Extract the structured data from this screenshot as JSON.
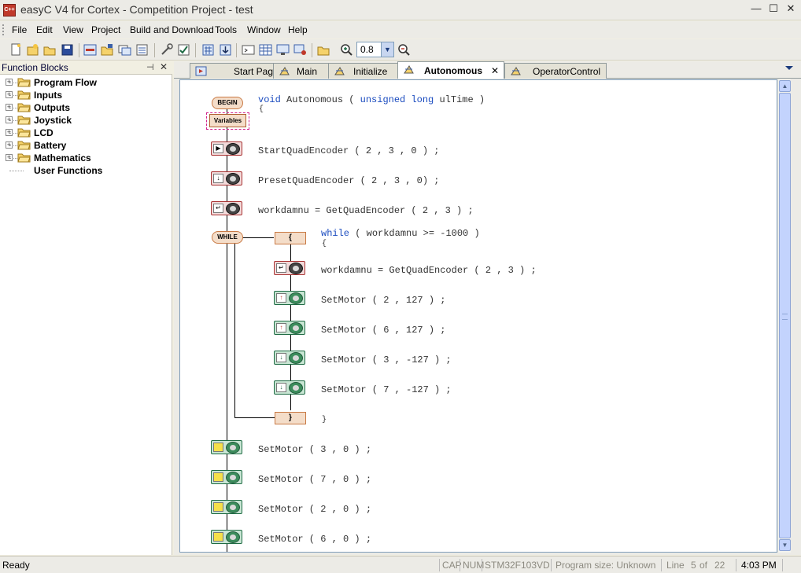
{
  "window": {
    "icon_label": "C++",
    "title": "easyC V4 for Cortex - Competition Project - test",
    "minimize": "—",
    "maximize": "☐",
    "close": "✕"
  },
  "menu": [
    "File",
    "Edit",
    "View",
    "Project",
    "Build and Download",
    "Tools",
    "Window",
    "Help"
  ],
  "toolbar": {
    "zoom_value": "0.8",
    "zoom_arrow": "▼"
  },
  "sidebar": {
    "title": "Function Blocks",
    "pin": "⊣",
    "close": "✕",
    "items": [
      {
        "label": "Program Flow",
        "expandable": true
      },
      {
        "label": "Inputs",
        "expandable": true
      },
      {
        "label": "Outputs",
        "expandable": true
      },
      {
        "label": "Joystick",
        "expandable": true
      },
      {
        "label": "LCD",
        "expandable": true
      },
      {
        "label": "Battery",
        "expandable": true
      },
      {
        "label": "Mathematics",
        "expandable": true
      },
      {
        "label": "User Functions",
        "expandable": false
      }
    ]
  },
  "tabs": [
    {
      "label": "Start Page"
    },
    {
      "label": "Main"
    },
    {
      "label": "Initialize"
    },
    {
      "label": "Autonomous",
      "active": true
    },
    {
      "label": "OperatorControl"
    }
  ],
  "tab_close": "✕",
  "editor": {
    "begin_label": "BEGIN",
    "variables_label": "Variables",
    "while_label": "WHILE",
    "loop_open": "{",
    "loop_close": "}",
    "header": {
      "kw1": "void",
      "name": "Autonomous",
      "paren_open": "(",
      "kw2": "unsigned long",
      "param": "ulTime",
      "paren_close": ")",
      "brace": "{"
    },
    "lines": [
      "StartQuadEncoder ( 2 , 3 , 0 ) ;",
      "PresetQuadEncoder ( 2 , 3 , 0) ;",
      "workdamnu = GetQuadEncoder ( 2 , 3 ) ;"
    ],
    "while_line": {
      "kw": "while",
      "cond": "( workdamnu >= -1000 )",
      "brace": "{"
    },
    "loop_lines": [
      "workdamnu = GetQuadEncoder ( 2 , 3 ) ;",
      "SetMotor ( 2 , 127 ) ;",
      "SetMotor ( 6 , 127 ) ;",
      "SetMotor ( 3 , -127 ) ;",
      "SetMotor ( 7 , -127 ) ;"
    ],
    "loop_end_brace": "}",
    "after_lines": [
      "SetMotor ( 3 , 0 ) ;",
      "SetMotor ( 7 , 0 ) ;",
      "SetMotor ( 2 , 0 ) ;",
      "SetMotor ( 6 , 0 ) ;"
    ]
  },
  "scrollbar": {
    "up": "▲",
    "down": "▼"
  },
  "status": {
    "ready": "Ready",
    "cap": "CAP",
    "num": "NUM",
    "device": "STM32F103VD",
    "program_size": "Program size: Unknown",
    "line_label": "Line",
    "line": "5",
    "of_label": "of",
    "total": "22",
    "time": "4:03 PM"
  },
  "colors": {
    "keyword": "#1a4bbf",
    "block_red": "#a83232",
    "block_green": "#1f6b44",
    "block_orange": "#f4ddc9"
  }
}
